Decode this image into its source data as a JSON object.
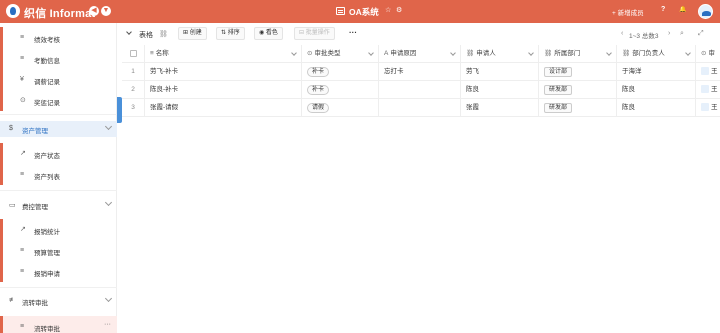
{
  "topbar": {
    "brand": "织信 Informat",
    "icon_left_1": "◀",
    "icon_left_2": "▼",
    "app_title": "OA系统",
    "star": "☆",
    "settings": "⚙",
    "add_member": "+ 新增成员",
    "help": "?",
    "bell": "🔔",
    "accent": "#e0654a"
  },
  "sidebar": {
    "items_top": [
      {
        "label": "绩效考核",
        "icon": "≡"
      },
      {
        "label": "考勤信息",
        "icon": "≡"
      },
      {
        "label": "调薪记录",
        "icon": "¥"
      },
      {
        "label": "奖惩记录",
        "icon": "⊙"
      }
    ],
    "groups": [
      {
        "label": "资产管理",
        "icon": "$"
      },
      {
        "label": "费控管理",
        "icon": "▭"
      },
      {
        "label": "流转审批",
        "icon": "≢"
      }
    ],
    "asset_items": [
      {
        "label": "资产状态",
        "icon": "↗"
      },
      {
        "label": "资产列表",
        "icon": "≡"
      }
    ],
    "expense_items": [
      {
        "label": "报销统计",
        "icon": "↗"
      },
      {
        "label": "预算管理",
        "icon": "≡"
      },
      {
        "label": "报销申请",
        "icon": "≡"
      }
    ],
    "approval_items": [
      {
        "label": "流转审批",
        "icon": "≡",
        "more": "···"
      }
    ]
  },
  "toolbar": {
    "title": "表格",
    "link_icon": "⛓",
    "add": "⊞ 创建",
    "sort": "⇅ 排序",
    "view": "◉ 看色",
    "batch": "⊟ 批量操作",
    "more": "···",
    "pager_prev": "‹",
    "pager_text": "1~3 总数3",
    "pager_next": "›",
    "search": "⌕",
    "zoom": "⤢"
  },
  "table": {
    "headers": {
      "name": "名称",
      "type": "审批类型",
      "reason": "申请原因",
      "applicant": "申请人",
      "dept": "所属部门",
      "head": "部门负责人",
      "approver": "审"
    },
    "header_icons": {
      "name": "≡",
      "type": "⊙",
      "reason": "A",
      "applicant": "⛓",
      "dept": "⛓",
      "head": "⛓",
      "approver": "⊙"
    },
    "rows": [
      {
        "num": "1",
        "name": "劳飞-补卡",
        "type": "补卡",
        "reason": "忘打卡",
        "applicant": "劳飞",
        "dept": "设计部",
        "head": "于海洋",
        "approver": "王"
      },
      {
        "num": "2",
        "name": "陈良-补卡",
        "type": "补卡",
        "reason": "",
        "applicant": "陈良",
        "dept": "研发部",
        "head": "陈良",
        "approver": "王"
      },
      {
        "num": "3",
        "name": "张霞-请假",
        "type": "请假",
        "reason": "",
        "applicant": "张霞",
        "dept": "研发部",
        "head": "陈良",
        "approver": "王"
      }
    ]
  }
}
